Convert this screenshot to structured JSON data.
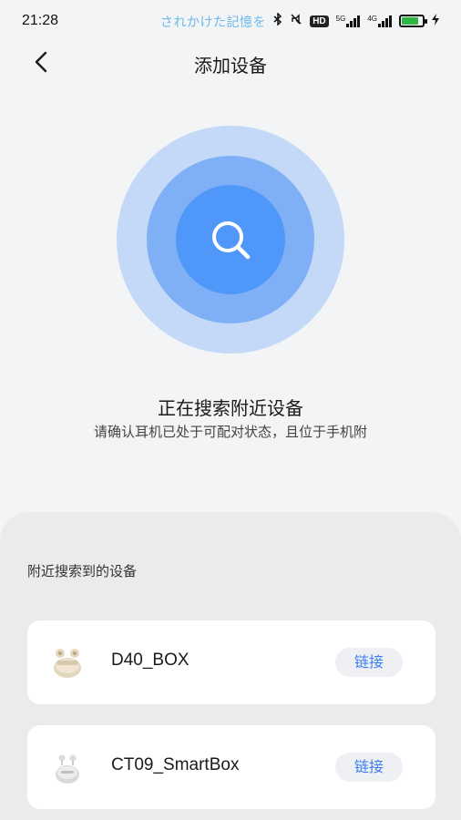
{
  "status_bar": {
    "time": "21:28",
    "ticker_text": "されかけた記憶を ",
    "hd_label": "HD",
    "signal1_label": "5G",
    "signal2_label": "4G",
    "battery_level": 0.8,
    "icons": [
      "bluetooth-icon",
      "mute-icon",
      "hd-badge",
      "signal-5g-icon",
      "signal-4g-icon",
      "battery-icon",
      "charging-icon"
    ]
  },
  "header": {
    "title": "添加设备",
    "back_icon": "chevron-left-icon"
  },
  "search": {
    "icon": "search-icon",
    "title": "正在搜索附近设备",
    "subtitle": "请确认耳机已处于可配对状态，且位于手机附"
  },
  "panel": {
    "heading": "附近搜索到的设备",
    "devices": [
      {
        "name": "D40_BOX",
        "action": "链接",
        "thumb": "earbuds-case-icon"
      },
      {
        "name": "CT09_SmartBox",
        "action": "链接",
        "thumb": "earbuds-case-icon"
      }
    ]
  },
  "colors": {
    "background": "#f3f4f6",
    "panel": "#ebebeb",
    "ring_outer": "#c3d9f7",
    "ring_mid": "#7fb0f5",
    "ring_inner": "#4f97f8",
    "accent": "#3d7ef0"
  }
}
